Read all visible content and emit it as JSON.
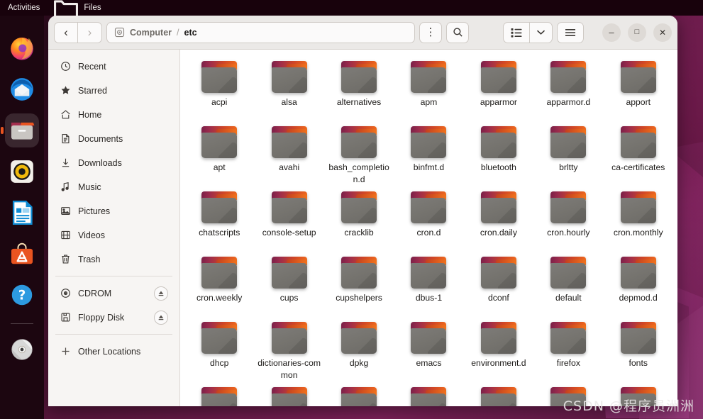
{
  "desktop": {
    "topbar": {
      "activities": "Activities",
      "app_name": "Files",
      "app_icon": "folder-icon"
    },
    "dock": {
      "items": [
        {
          "name": "firefox",
          "label": "Firefox",
          "icon": "firefox-icon",
          "active": false
        },
        {
          "name": "thunderbird",
          "label": "Thunderbird",
          "icon": "thunderbird-icon",
          "active": false
        },
        {
          "name": "files",
          "label": "Files",
          "icon": "files-icon",
          "active": true
        },
        {
          "name": "rhythmbox",
          "label": "Rhythmbox",
          "icon": "rhythmbox-icon",
          "active": false
        },
        {
          "name": "libreoffice-writer",
          "label": "LibreOffice Writer",
          "icon": "document-icon",
          "active": false
        },
        {
          "name": "ubuntu-software",
          "label": "Ubuntu Software",
          "icon": "software-bag-icon",
          "active": false
        },
        {
          "name": "help",
          "label": "Help",
          "icon": "question-mark-icon",
          "active": false
        },
        {
          "name": "cdrom-disc",
          "label": "CDROM",
          "icon": "optical-disc-icon",
          "active": false
        }
      ]
    },
    "wallpaper_color": "#5d1840",
    "accent_color": "#e95420",
    "watermark": "CSDN @程序员洲洲"
  },
  "window": {
    "headerbar": {
      "back_label": "‹",
      "forward_label": "›",
      "menu_label": "⋮",
      "search_label": "search-icon",
      "view_label": "list-view-icon",
      "view_chevron_label": "˅",
      "hamburger_label": "☰",
      "minimize_label": "–",
      "maximize_label": "□",
      "close_label": "✕"
    },
    "pathbar": {
      "drive_icon": "drive-harddisk-icon",
      "crumbs": [
        "Computer",
        "etc"
      ],
      "separator": "/"
    },
    "sidebar": {
      "groups": [
        {
          "items": [
            {
              "label": "Recent",
              "icon": "clock-icon",
              "eject": false
            },
            {
              "label": "Starred",
              "icon": "star-icon",
              "eject": false
            },
            {
              "label": "Home",
              "icon": "home-icon",
              "eject": false
            },
            {
              "label": "Documents",
              "icon": "document-icon",
              "eject": false
            },
            {
              "label": "Downloads",
              "icon": "download-icon",
              "eject": false
            },
            {
              "label": "Music",
              "icon": "music-note-icon",
              "eject": false
            },
            {
              "label": "Pictures",
              "icon": "image-icon",
              "eject": false
            },
            {
              "label": "Videos",
              "icon": "film-icon",
              "eject": false
            },
            {
              "label": "Trash",
              "icon": "trash-icon",
              "eject": false
            }
          ]
        },
        {
          "items": [
            {
              "label": "CDROM",
              "icon": "optical-disc-icon",
              "eject": true
            },
            {
              "label": "Floppy Disk",
              "icon": "floppy-icon",
              "eject": true
            }
          ]
        },
        {
          "items": [
            {
              "label": "Other Locations",
              "icon": "plus-icon",
              "eject": false
            }
          ]
        }
      ]
    },
    "files": {
      "icon_type": "folder-icon",
      "rows": [
        [
          "acpi",
          "alsa",
          "alternatives",
          "apm",
          "apparmor",
          "apparmor.d",
          "apport"
        ],
        [
          "apt",
          "avahi",
          "bash_completion.d",
          "binfmt.d",
          "bluetooth",
          "brltty",
          "ca-certificates"
        ],
        [
          "chatscripts",
          "console-setup",
          "cracklib",
          "cron.d",
          "cron.daily",
          "cron.hourly",
          "cron.monthly"
        ],
        [
          "cron.weekly",
          "cups",
          "cupshelpers",
          "dbus-1",
          "dconf",
          "default",
          "depmod.d"
        ],
        [
          "dhcp",
          "dictionaries-common",
          "dpkg",
          "emacs",
          "environment.d",
          "firefox",
          "fonts"
        ],
        [
          "",
          "",
          "",
          "",
          "",
          "",
          ""
        ]
      ]
    }
  }
}
